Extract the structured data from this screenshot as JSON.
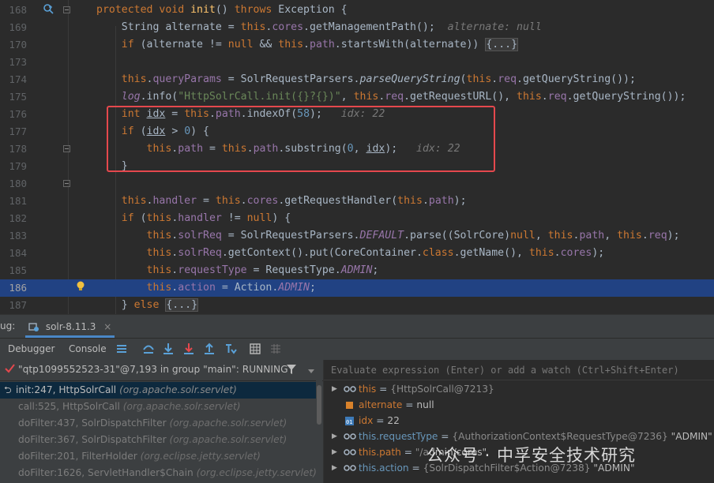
{
  "editor": {
    "lines": [
      {
        "num": "168",
        "tokens": [
          {
            "t": "protected void ",
            "c": "k"
          },
          {
            "t": "init",
            "c": "m"
          },
          {
            "t": "() ",
            "c": ""
          },
          {
            "t": "throws ",
            "c": "k"
          },
          {
            "t": "Exception {",
            "c": ""
          }
        ]
      },
      {
        "num": "169",
        "tokens": [
          {
            "t": "    String alternate = ",
            "c": ""
          },
          {
            "t": "this",
            "c": "k"
          },
          {
            "t": ".",
            "c": ""
          },
          {
            "t": "cores",
            "c": "f"
          },
          {
            "t": ".getManagementPath();  ",
            "c": ""
          },
          {
            "t": "alternate: null",
            "c": "hint"
          }
        ]
      },
      {
        "num": "170",
        "tokens": [
          {
            "t": "    ",
            "c": ""
          },
          {
            "t": "if ",
            "c": "k"
          },
          {
            "t": "(alternate != ",
            "c": ""
          },
          {
            "t": "null ",
            "c": "k"
          },
          {
            "t": "&& ",
            "c": ""
          },
          {
            "t": "this",
            "c": "k"
          },
          {
            "t": ".",
            "c": ""
          },
          {
            "t": "path",
            "c": "f"
          },
          {
            "t": ".startsWith(alternate)) ",
            "c": ""
          },
          {
            "t": "{...}",
            "c": "fold"
          }
        ]
      },
      {
        "num": "173",
        "tokens": []
      },
      {
        "num": "174",
        "tokens": [
          {
            "t": "    ",
            "c": ""
          },
          {
            "t": "this",
            "c": "k"
          },
          {
            "t": ".",
            "c": ""
          },
          {
            "t": "queryParams",
            "c": "f"
          },
          {
            "t": " = SolrRequestParsers.",
            "c": ""
          },
          {
            "t": "parseQueryString",
            "c": "si"
          },
          {
            "t": "(",
            "c": ""
          },
          {
            "t": "this",
            "c": "k"
          },
          {
            "t": ".",
            "c": ""
          },
          {
            "t": "req",
            "c": "f"
          },
          {
            "t": ".getQueryString());",
            "c": ""
          }
        ]
      },
      {
        "num": "175",
        "tokens": [
          {
            "t": "    ",
            "c": ""
          },
          {
            "t": "log",
            "c": "i"
          },
          {
            "t": ".info(",
            "c": ""
          },
          {
            "t": "\"HttpSolrCall.init({}?{})\"",
            "c": "s"
          },
          {
            "t": ", ",
            "c": ""
          },
          {
            "t": "this",
            "c": "k"
          },
          {
            "t": ".",
            "c": ""
          },
          {
            "t": "req",
            "c": "f"
          },
          {
            "t": ".getRequestURL(), ",
            "c": ""
          },
          {
            "t": "this",
            "c": "k"
          },
          {
            "t": ".",
            "c": ""
          },
          {
            "t": "req",
            "c": "f"
          },
          {
            "t": ".getQueryString());",
            "c": ""
          }
        ]
      },
      {
        "num": "176",
        "tokens": [
          {
            "t": "    ",
            "c": ""
          },
          {
            "t": "int ",
            "c": "k"
          },
          {
            "t": "idx",
            "c": "ul"
          },
          {
            "t": " = ",
            "c": ""
          },
          {
            "t": "this",
            "c": "k"
          },
          {
            "t": ".",
            "c": ""
          },
          {
            "t": "path",
            "c": "f"
          },
          {
            "t": ".indexOf(",
            "c": ""
          },
          {
            "t": "58",
            "c": "n"
          },
          {
            "t": ");   ",
            "c": ""
          },
          {
            "t": "idx: 22",
            "c": "hint"
          }
        ]
      },
      {
        "num": "177",
        "tokens": [
          {
            "t": "    ",
            "c": ""
          },
          {
            "t": "if ",
            "c": "k"
          },
          {
            "t": "(",
            "c": ""
          },
          {
            "t": "idx",
            "c": "ul"
          },
          {
            "t": " > ",
            "c": ""
          },
          {
            "t": "0",
            "c": "n"
          },
          {
            "t": ") {",
            "c": ""
          }
        ]
      },
      {
        "num": "178",
        "tokens": [
          {
            "t": "        ",
            "c": ""
          },
          {
            "t": "this",
            "c": "k"
          },
          {
            "t": ".",
            "c": ""
          },
          {
            "t": "path",
            "c": "f"
          },
          {
            "t": " = ",
            "c": ""
          },
          {
            "t": "this",
            "c": "k"
          },
          {
            "t": ".",
            "c": ""
          },
          {
            "t": "path",
            "c": "f"
          },
          {
            "t": ".substring(",
            "c": ""
          },
          {
            "t": "0",
            "c": "n"
          },
          {
            "t": ", ",
            "c": ""
          },
          {
            "t": "idx",
            "c": "ul"
          },
          {
            "t": ");   ",
            "c": ""
          },
          {
            "t": "idx: 22",
            "c": "hint"
          }
        ]
      },
      {
        "num": "179",
        "tokens": [
          {
            "t": "    }",
            "c": ""
          }
        ]
      },
      {
        "num": "180",
        "tokens": []
      },
      {
        "num": "181",
        "tokens": [
          {
            "t": "    ",
            "c": ""
          },
          {
            "t": "this",
            "c": "k"
          },
          {
            "t": ".",
            "c": ""
          },
          {
            "t": "handler",
            "c": "f"
          },
          {
            "t": " = ",
            "c": ""
          },
          {
            "t": "this",
            "c": "k"
          },
          {
            "t": ".",
            "c": ""
          },
          {
            "t": "cores",
            "c": "f"
          },
          {
            "t": ".getRequestHandler(",
            "c": ""
          },
          {
            "t": "this",
            "c": "k"
          },
          {
            "t": ".",
            "c": ""
          },
          {
            "t": "path",
            "c": "f"
          },
          {
            "t": ");",
            "c": ""
          }
        ]
      },
      {
        "num": "182",
        "tokens": [
          {
            "t": "    ",
            "c": ""
          },
          {
            "t": "if ",
            "c": "k"
          },
          {
            "t": "(",
            "c": ""
          },
          {
            "t": "this",
            "c": "k"
          },
          {
            "t": ".",
            "c": ""
          },
          {
            "t": "handler",
            "c": "f"
          },
          {
            "t": " != ",
            "c": ""
          },
          {
            "t": "null",
            "c": "k"
          },
          {
            "t": ") {",
            "c": ""
          }
        ]
      },
      {
        "num": "183",
        "tokens": [
          {
            "t": "        ",
            "c": ""
          },
          {
            "t": "this",
            "c": "k"
          },
          {
            "t": ".",
            "c": ""
          },
          {
            "t": "solrReq",
            "c": "f"
          },
          {
            "t": " = SolrRequestParsers.",
            "c": ""
          },
          {
            "t": "DEFAULT",
            "c": "i"
          },
          {
            "t": ".parse((SolrCore)",
            "c": ""
          },
          {
            "t": "null",
            "c": "k"
          },
          {
            "t": ", ",
            "c": ""
          },
          {
            "t": "this",
            "c": "k"
          },
          {
            "t": ".",
            "c": ""
          },
          {
            "t": "path",
            "c": "f"
          },
          {
            "t": ", ",
            "c": ""
          },
          {
            "t": "this",
            "c": "k"
          },
          {
            "t": ".",
            "c": ""
          },
          {
            "t": "req",
            "c": "f"
          },
          {
            "t": ");",
            "c": ""
          }
        ]
      },
      {
        "num": "184",
        "tokens": [
          {
            "t": "        ",
            "c": ""
          },
          {
            "t": "this",
            "c": "k"
          },
          {
            "t": ".",
            "c": ""
          },
          {
            "t": "solrReq",
            "c": "f"
          },
          {
            "t": ".getContext().put(CoreContainer.",
            "c": ""
          },
          {
            "t": "class",
            "c": "k"
          },
          {
            "t": ".getName(), ",
            "c": ""
          },
          {
            "t": "this",
            "c": "k"
          },
          {
            "t": ".",
            "c": ""
          },
          {
            "t": "cores",
            "c": "f"
          },
          {
            "t": ");",
            "c": ""
          }
        ]
      },
      {
        "num": "185",
        "tokens": [
          {
            "t": "        ",
            "c": ""
          },
          {
            "t": "this",
            "c": "k"
          },
          {
            "t": ".",
            "c": ""
          },
          {
            "t": "requestType",
            "c": "f"
          },
          {
            "t": " = RequestType.",
            "c": ""
          },
          {
            "t": "ADMIN",
            "c": "i"
          },
          {
            "t": ";",
            "c": ""
          }
        ]
      },
      {
        "num": "186",
        "tokens": [
          {
            "t": "        ",
            "c": ""
          },
          {
            "t": "this",
            "c": "k"
          },
          {
            "t": ".",
            "c": ""
          },
          {
            "t": "action",
            "c": "f"
          },
          {
            "t": " = Action.",
            "c": ""
          },
          {
            "t": "ADMIN",
            "c": "i"
          },
          {
            "t": ";",
            "c": ""
          }
        ],
        "current": true
      },
      {
        "num": "187",
        "tokens": [
          {
            "t": "    } ",
            "c": ""
          },
          {
            "t": "else ",
            "c": "k"
          },
          {
            "t": "{...}",
            "c": "fold"
          }
        ]
      }
    ]
  },
  "debug": {
    "label": "ug:",
    "session_tab": "solr-8.11.3",
    "close_glyph": "×",
    "tab_debugger": "Debugger",
    "tab_console": "Console"
  },
  "thread": {
    "text": "\"qtp1099552523-31\"@7,193 in group \"main\": RUNNING"
  },
  "frames": [
    {
      "name": "init:247, HttpSolrCall",
      "pkg": "(org.apache.solr.servlet)",
      "selected": true
    },
    {
      "name": "call:525, HttpSolrCall",
      "pkg": "(org.apache.solr.servlet)"
    },
    {
      "name": "doFilter:437, SolrDispatchFilter",
      "pkg": "(org.apache.solr.servlet)"
    },
    {
      "name": "doFilter:367, SolrDispatchFilter",
      "pkg": "(org.apache.solr.servlet)"
    },
    {
      "name": "doFilter:201, FilterHolder",
      "pkg": "(org.eclipse.jetty.servlet)"
    },
    {
      "name": "doFilter:1626, ServletHandler$Chain",
      "pkg": "(org.eclipse.jetty.servlet)"
    }
  ],
  "eval_placeholder": "Evaluate expression (Enter) or add a watch (Ctrl+Shift+Enter)",
  "variables": [
    {
      "name": "this",
      "eq": " = ",
      "type": "{HttpSolrCall@7213}",
      "str": "",
      "expandable": true,
      "icon": "glasses-icon",
      "nameColor": "orange"
    },
    {
      "name": "alternate",
      "eq": " = ",
      "type": "",
      "str": "null",
      "expandable": false,
      "icon": "field-icon",
      "nameColor": "orange"
    },
    {
      "name": "idx",
      "eq": " = ",
      "type": "",
      "str": "22",
      "expandable": false,
      "icon": "primitive-icon",
      "nameColor": "orange"
    },
    {
      "name": "this.requestType",
      "eq": " = ",
      "type": "{AuthorizationContext$RequestType@7236}",
      "str": " \"ADMIN\"",
      "expandable": true,
      "icon": "glasses-icon",
      "nameColor": "blue"
    },
    {
      "name": "this.path",
      "eq": " = ",
      "type": "\"/a",
      "str": "dmin/cores\"",
      "expandable": true,
      "icon": "glasses-icon",
      "nameColor": "orange"
    },
    {
      "name": "this.action",
      "eq": " = ",
      "type": "{SolrDispatchFilter$Action@7238}",
      "str": " \"ADMIN\"",
      "expandable": true,
      "icon": "glasses-icon",
      "nameColor": "blue"
    }
  ],
  "watermark": "公众号 · 中孚安全技术研究"
}
